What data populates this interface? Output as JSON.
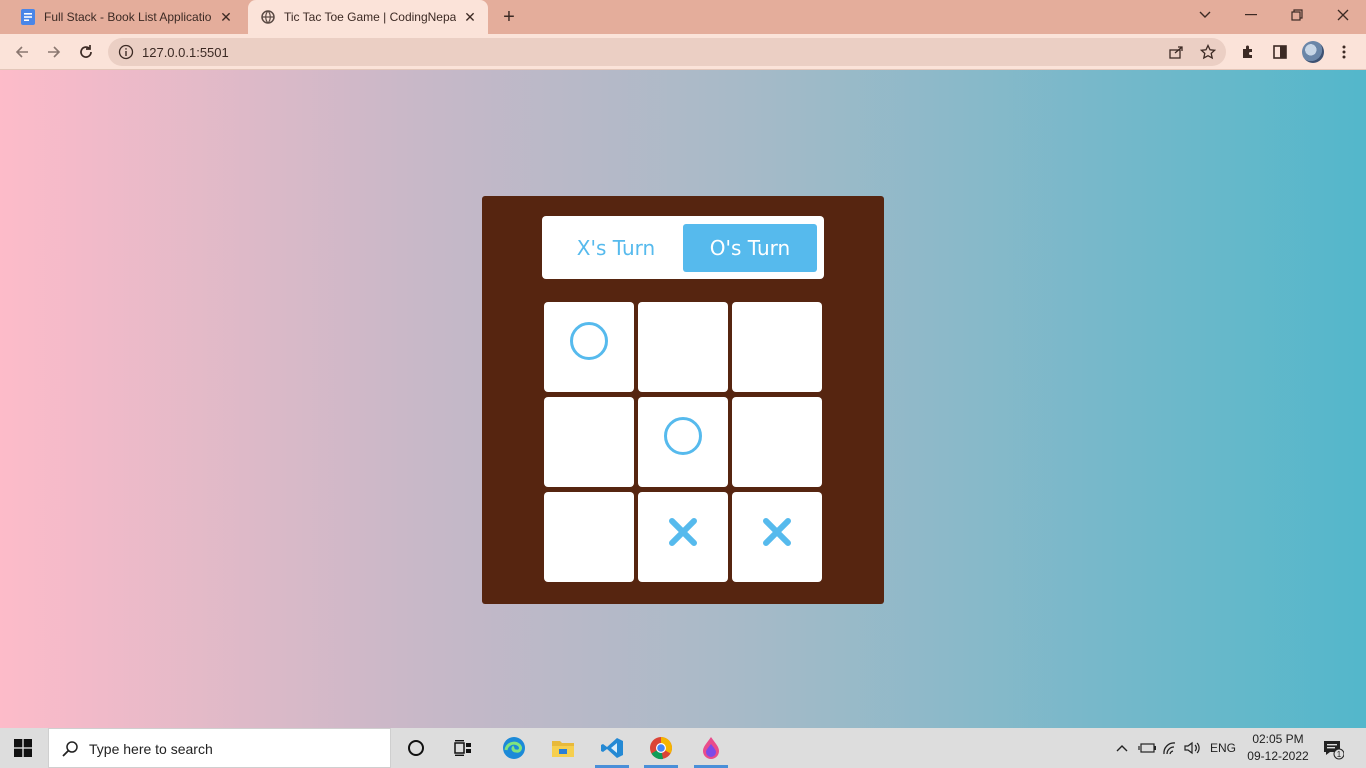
{
  "browser": {
    "tabs": [
      {
        "title": "Full Stack - Book List Application",
        "favicon": "docs-icon",
        "active": false
      },
      {
        "title": "Tic Tac Toe Game | CodingNepal",
        "favicon": "globe-icon",
        "active": true
      }
    ],
    "address": "127.0.0.1:5501"
  },
  "game": {
    "turns": {
      "x_label": "X's Turn",
      "o_label": "O's Turn",
      "active": "O"
    },
    "board": [
      "O",
      "",
      "",
      "",
      "O",
      "",
      "",
      "X",
      "X"
    ],
    "colors": {
      "accent": "#56baed",
      "board_bg": "#562510"
    }
  },
  "taskbar": {
    "search_placeholder": "Type here to search",
    "language": "ENG",
    "time": "02:05 PM",
    "date": "09-12-2022",
    "notification_count": "1"
  }
}
